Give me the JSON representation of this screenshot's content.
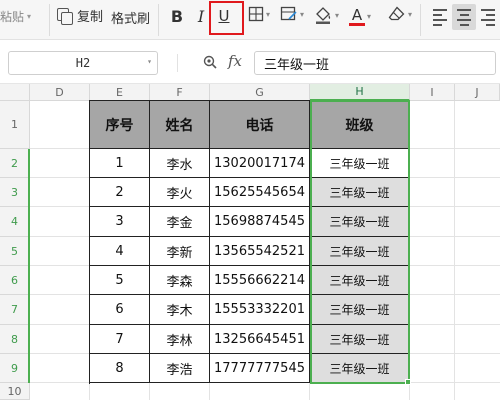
{
  "toolbar": {
    "paste_label": "粘贴",
    "copy_label": "复制",
    "format_painter_label": "格式刷",
    "bold_label": "B",
    "italic_label": "I",
    "underline_label": "U",
    "font_color_label": "A",
    "highlighted_tool": "underline",
    "highlight_color": "#e0191d",
    "font_color": "#e0191d"
  },
  "formula_bar": {
    "cell_reference": "H2",
    "fx_label": "fx",
    "formula_value": "三年级一班"
  },
  "grid": {
    "columns": [
      "D",
      "E",
      "F",
      "G",
      "H",
      "I",
      "J"
    ],
    "selected_column": "H",
    "rows": [
      "1",
      "2",
      "3",
      "4",
      "5",
      "6",
      "7",
      "8",
      "9",
      "10"
    ],
    "selected_rows": [
      "2",
      "3",
      "4",
      "5",
      "6",
      "7",
      "8",
      "9"
    ],
    "accent_color": "#4caf50"
  },
  "table": {
    "headers": [
      "序号",
      "姓名",
      "电话",
      "班级"
    ],
    "rows": [
      [
        "1",
        "李水",
        "13020017174",
        "三年级一班"
      ],
      [
        "2",
        "李火",
        "15625545654",
        "三年级一班"
      ],
      [
        "3",
        "李金",
        "15698874545",
        "三年级一班"
      ],
      [
        "4",
        "李新",
        "13565542521",
        "三年级一班"
      ],
      [
        "5",
        "李森",
        "15556662214",
        "三年级一班"
      ],
      [
        "6",
        "李木",
        "15553332201",
        "三年级一班"
      ],
      [
        "7",
        "李林",
        "13256645451",
        "三年级一班"
      ],
      [
        "8",
        "李浩",
        "17777777545",
        "三年级一班"
      ]
    ],
    "header_fill": "#a6a6a6",
    "class_fill": "#dedede"
  }
}
